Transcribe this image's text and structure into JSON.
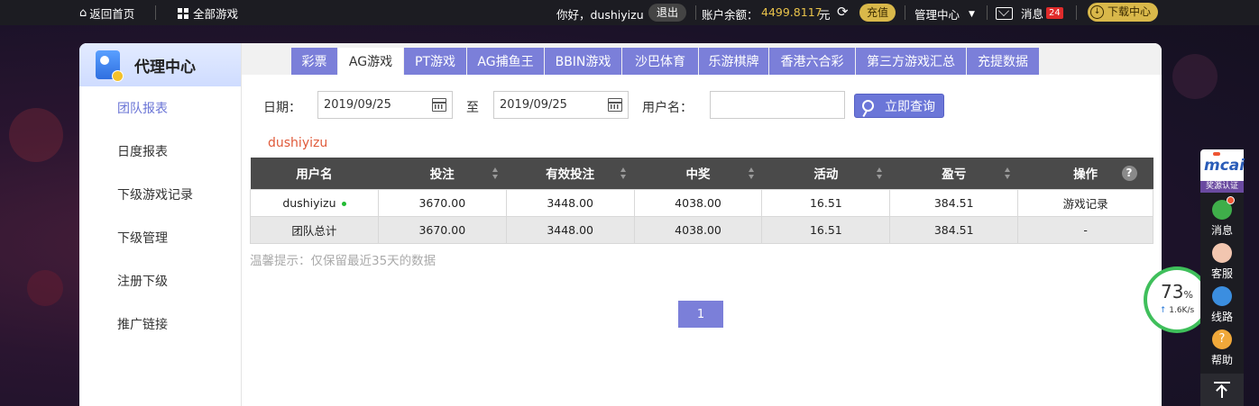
{
  "topbar": {
    "home": "返回首页",
    "all_games": "全部游戏",
    "greeting": "你好，dushiyizu",
    "logout": "退出",
    "balance_label": "账户余额：",
    "balance_value": "4499.8117",
    "balance_unit": "元",
    "recharge": "充值",
    "manage": "管理中心",
    "messages": "消息",
    "message_count": "24",
    "download": "下载中心"
  },
  "sidebar": {
    "title": "代理中心",
    "items": [
      {
        "label": "团队报表",
        "active": true
      },
      {
        "label": "日度报表"
      },
      {
        "label": "下级游戏记录"
      },
      {
        "label": "下级管理"
      },
      {
        "label": "注册下级"
      },
      {
        "label": "推广链接"
      }
    ]
  },
  "tabs": [
    {
      "label": "彩票"
    },
    {
      "label": "AG游戏",
      "active": true
    },
    {
      "label": "PT游戏"
    },
    {
      "label": "AG捕鱼王"
    },
    {
      "label": "BBIN游戏"
    },
    {
      "label": "沙巴体育"
    },
    {
      "label": "乐游棋牌"
    },
    {
      "label": "香港六合彩"
    },
    {
      "label": "第三方游戏汇总"
    },
    {
      "label": "充提数据"
    }
  ],
  "filter": {
    "date_label": "日期：",
    "date_from": "2019/09/25",
    "to_label": "至",
    "date_to": "2019/09/25",
    "username_label": "用户名：",
    "username_value": "",
    "query_button": "立即查询"
  },
  "current_user": "dushiyizu",
  "table": {
    "headers": [
      "用户名",
      "投注",
      "有效投注",
      "中奖",
      "活动",
      "盈亏",
      "操作"
    ],
    "rows": [
      [
        "dushiyizu",
        "3670.00",
        "3448.00",
        "4038.00",
        "16.51",
        "384.51",
        "游戏记录"
      ],
      [
        "团队总计",
        "3670.00",
        "3448.00",
        "4038.00",
        "16.51",
        "384.51",
        "-"
      ]
    ]
  },
  "tip": "温馨提示：仅保留最近35天的数据",
  "pagination": {
    "current": "1"
  },
  "floatbar": {
    "logo": "mcai",
    "logo_caption": "奖源认证",
    "items": [
      {
        "label": "消息",
        "icon": "chat-icon"
      },
      {
        "label": "客服",
        "icon": "agent-icon"
      },
      {
        "label": "线路",
        "icon": "speedometer-icon"
      },
      {
        "label": "帮助",
        "icon": "help-icon"
      }
    ]
  },
  "speed_widget": {
    "percent": "73",
    "percent_unit": "%",
    "rate": "1.6K/s"
  },
  "colors": {
    "accent": "#7b7fd9",
    "header_dark": "#4a4a4a",
    "balance": "#e8c24a",
    "highlight_user": "#e05a3a"
  }
}
